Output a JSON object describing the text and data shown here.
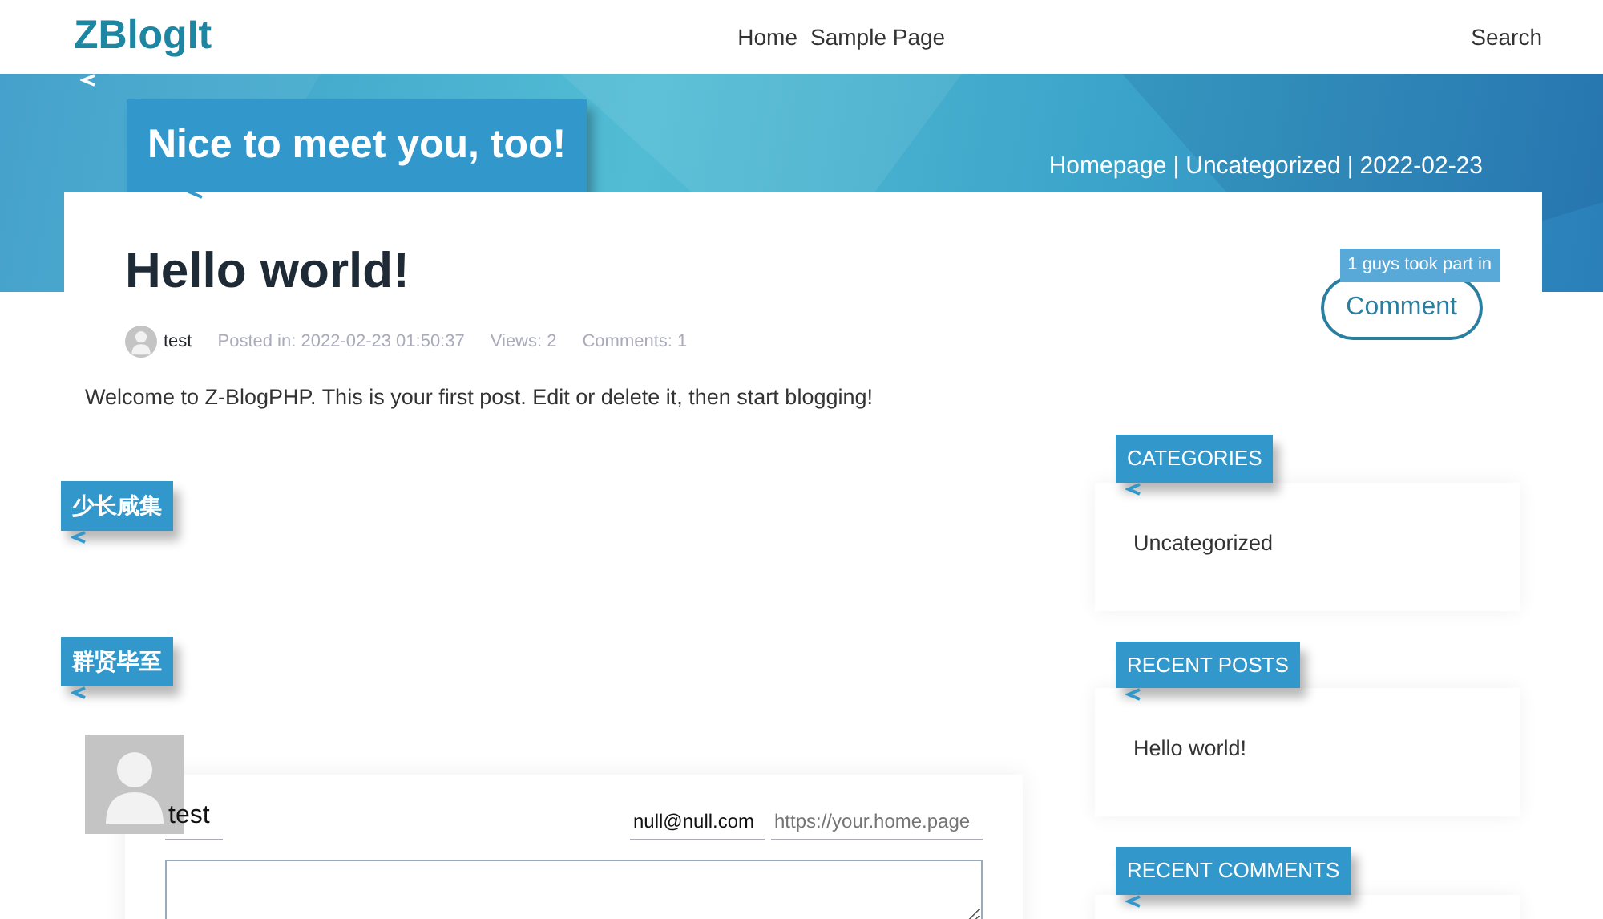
{
  "site": {
    "brand": "ZBlogIt",
    "nav": [
      {
        "label": "Home"
      },
      {
        "label": "Sample Page"
      }
    ],
    "search": "Search"
  },
  "hero": {
    "ribbon": "Nice to meet you, too!",
    "breadcrumb": [
      "Homepage",
      "Uncategorized",
      "2022-02-23"
    ],
    "separator": "|"
  },
  "post": {
    "title": "Hello world!",
    "author": "test",
    "posted_label": "Posted in:",
    "posted": "2022-02-23 01:50:37",
    "views_label": "Views:",
    "views": "2",
    "comments_label": "Comments:",
    "comments": "1",
    "comment_badge": "1 guys took part in",
    "comment_button": "Comment",
    "body": "Welcome to Z-BlogPHP. This is your first post. Edit or delete it, then start blogging!"
  },
  "sections": [
    "少长咸集",
    "群贤毕至"
  ],
  "comment_form": {
    "name": "test",
    "email": "null@null.com",
    "url_placeholder": "https://your.home.page"
  },
  "sidebar": [
    {
      "title": "CATEGORIES",
      "items": [
        "Uncategorized"
      ]
    },
    {
      "title": "RECENT POSTS",
      "items": [
        "Hello world!"
      ]
    },
    {
      "title": "RECENT COMMENTS"
    }
  ]
}
